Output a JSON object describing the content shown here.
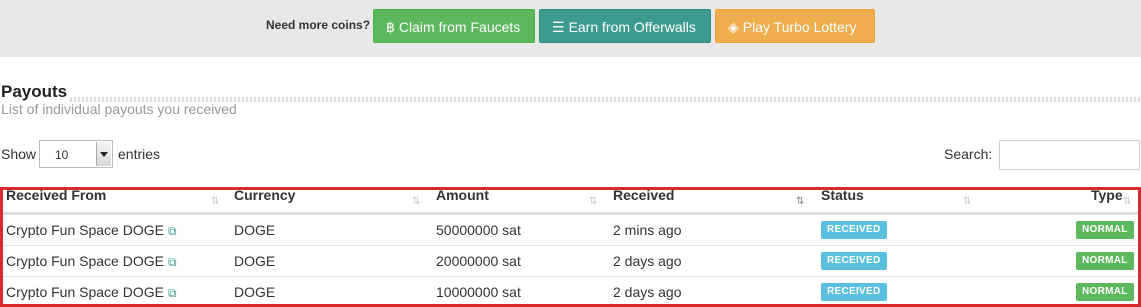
{
  "topbar": {
    "need_label": "Need more coins?",
    "faucet_button": "Claim from Faucets",
    "offerwall_button": "Earn from Offerwalls",
    "lottery_button": "Play Turbo Lottery"
  },
  "section": {
    "title": "Payouts",
    "subtitle": "List of individual payouts you received"
  },
  "controls": {
    "show_label": "Show",
    "entries_value": "10",
    "entries_label": "entries",
    "search_label": "Search:"
  },
  "table": {
    "headers": [
      "Received From",
      "Currency",
      "Amount",
      "Received",
      "Status",
      "Type"
    ],
    "rows": [
      {
        "from": "Crypto Fun Space DOGE",
        "currency": "DOGE",
        "amount": "50000000 sat",
        "received": "2 mins ago",
        "status": "RECEIVED",
        "type": "NORMAL"
      },
      {
        "from": "Crypto Fun Space DOGE",
        "currency": "DOGE",
        "amount": "20000000 sat",
        "received": "2 days ago",
        "status": "RECEIVED",
        "type": "NORMAL"
      },
      {
        "from": "Crypto Fun Space DOGE",
        "currency": "DOGE",
        "amount": "10000000 sat",
        "received": "2 days ago",
        "status": "RECEIVED",
        "type": "NORMAL"
      }
    ]
  },
  "colors": {
    "faucet": "#5cb85c",
    "offerwall": "#3d9a8f",
    "lottery": "#f0ad4e",
    "received_badge": "#5bc0de",
    "normal_badge": "#5cb85c",
    "highlight_frame": "#d92b2b"
  },
  "icons": {
    "faucet": "bitcoin-icon",
    "offerwall": "list-icon",
    "lottery": "ticket-icon",
    "source_link": "external-link-icon"
  }
}
